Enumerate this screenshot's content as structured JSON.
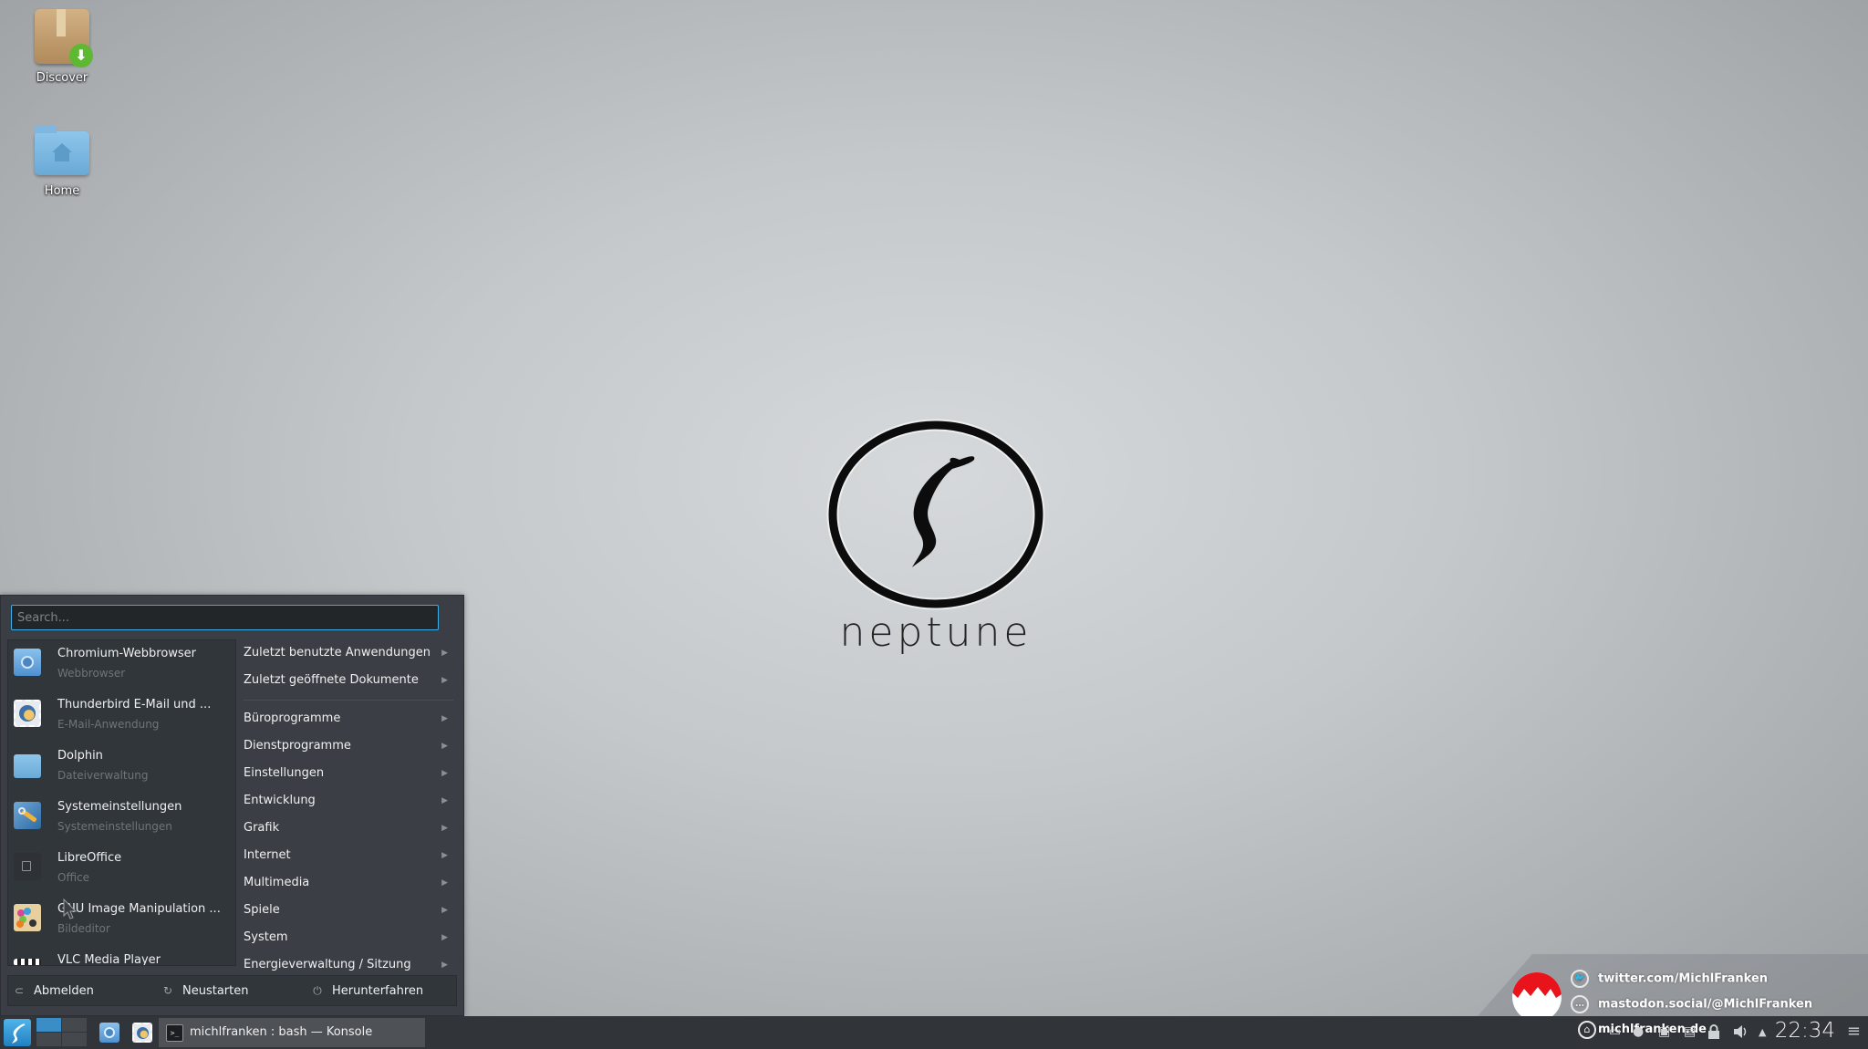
{
  "desktop": {
    "icons": [
      {
        "label": "Discover",
        "icon": "package-download-icon"
      },
      {
        "label": "Home",
        "icon": "home-folder-icon"
      }
    ],
    "wallpaper": {
      "brand": "neptune",
      "logo_icon": "neptune-swirl-icon"
    }
  },
  "start_menu": {
    "search": {
      "placeholder": "Search...",
      "value": ""
    },
    "favorites": [
      {
        "name": "Chromium-Webbrowser",
        "description": "Webbrowser",
        "icon": "chromium-icon"
      },
      {
        "name": "Thunderbird E-Mail und ...",
        "description": "E-Mail-Anwendung",
        "icon": "thunderbird-icon"
      },
      {
        "name": "Dolphin",
        "description": "Dateiverwaltung",
        "icon": "folder-icon"
      },
      {
        "name": "Systemeinstellungen",
        "description": "Systemeinstellungen",
        "icon": "wrench-settings-icon"
      },
      {
        "name": "LibreOffice",
        "description": "Office",
        "icon": "libreoffice-icon"
      },
      {
        "name": "GNU Image Manipulation ...",
        "description": "Bildeditor",
        "icon": "gimp-icon"
      },
      {
        "name": "VLC Media Player",
        "description": "",
        "icon": "vlc-icon"
      }
    ],
    "recent": [
      {
        "label": "Zuletzt benutzte Anwendungen"
      },
      {
        "label": "Zuletzt geöffnete Dokumente"
      }
    ],
    "categories": [
      {
        "label": "Büroprogramme"
      },
      {
        "label": "Dienstprogramme"
      },
      {
        "label": "Einstellungen"
      },
      {
        "label": "Entwicklung"
      },
      {
        "label": "Grafik"
      },
      {
        "label": "Internet"
      },
      {
        "label": "Multimedia"
      },
      {
        "label": "Spiele"
      },
      {
        "label": "System"
      },
      {
        "label": "Energieverwaltung / Sitzung"
      }
    ],
    "session": {
      "logout": "Abmelden",
      "restart": "Neustarten",
      "shutdown": "Herunterfahren"
    }
  },
  "taskbar": {
    "active_desktop": 1,
    "desktop_count": 4,
    "launchers": [
      {
        "name": "Chromium-Webbrowser",
        "icon": "chromium-icon"
      },
      {
        "name": "Thunderbird",
        "icon": "thunderbird-icon"
      }
    ],
    "tasks": [
      {
        "title": "michlfranken : bash — Konsole",
        "icon": "terminal-icon"
      }
    ],
    "tray": {
      "icons": [
        "clipboard-icon",
        "update-icon",
        "network-icon",
        "battery-icon",
        "lock-icon",
        "volume-icon",
        "expand-up-icon"
      ],
      "expand_glyph": "▲",
      "clock": "22:34",
      "menu_glyph": "≡"
    }
  },
  "watermark": {
    "lines": [
      {
        "icon": "twitter-icon",
        "text": "twitter.com/MichlFranken"
      },
      {
        "icon": "mastodon-icon",
        "text": "mastodon.social/@MichlFranken"
      },
      {
        "icon": "home-icon",
        "text": "michlfranken.de"
      }
    ],
    "badge_colors": {
      "top": "#e8131b",
      "bottom": "#ffffff"
    }
  },
  "colors": {
    "accent": "#3daee9",
    "menu_bg": "#3b3e44",
    "panel_bg": "#31353a"
  }
}
